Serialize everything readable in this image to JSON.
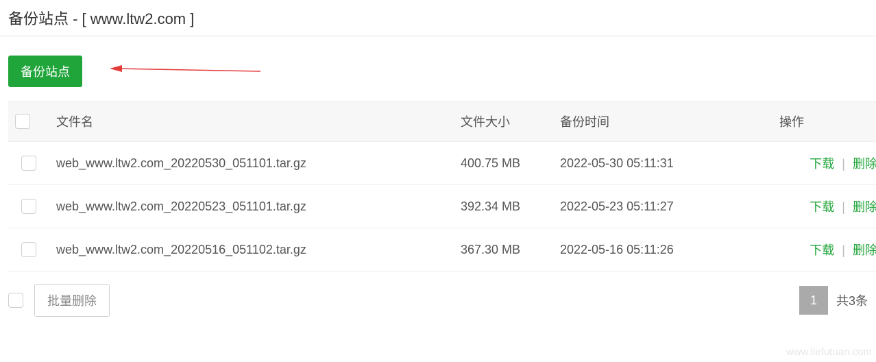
{
  "header": {
    "title": "备份站点 - [ www.ltw2.com ]"
  },
  "toolbar": {
    "backup_label": "备份站点"
  },
  "table": {
    "columns": {
      "filename": "文件名",
      "filesize": "文件大小",
      "backup_time": "备份时间",
      "operations": "操作"
    },
    "rows": [
      {
        "filename": "web_www.ltw2.com_20220530_051101.tar.gz",
        "filesize": "400.75 MB",
        "backup_time": "2022-05-30 05:11:31"
      },
      {
        "filename": "web_www.ltw2.com_20220523_051101.tar.gz",
        "filesize": "392.34 MB",
        "backup_time": "2022-05-23 05:11:27"
      },
      {
        "filename": "web_www.ltw2.com_20220516_051102.tar.gz",
        "filesize": "367.30 MB",
        "backup_time": "2022-05-16 05:11:26"
      }
    ],
    "actions": {
      "download": "下载",
      "delete": "删除"
    }
  },
  "footer": {
    "batch_delete": "批量删除",
    "page_current": "1",
    "total_label": "共3条"
  },
  "watermark": "www.liefutuan.com"
}
